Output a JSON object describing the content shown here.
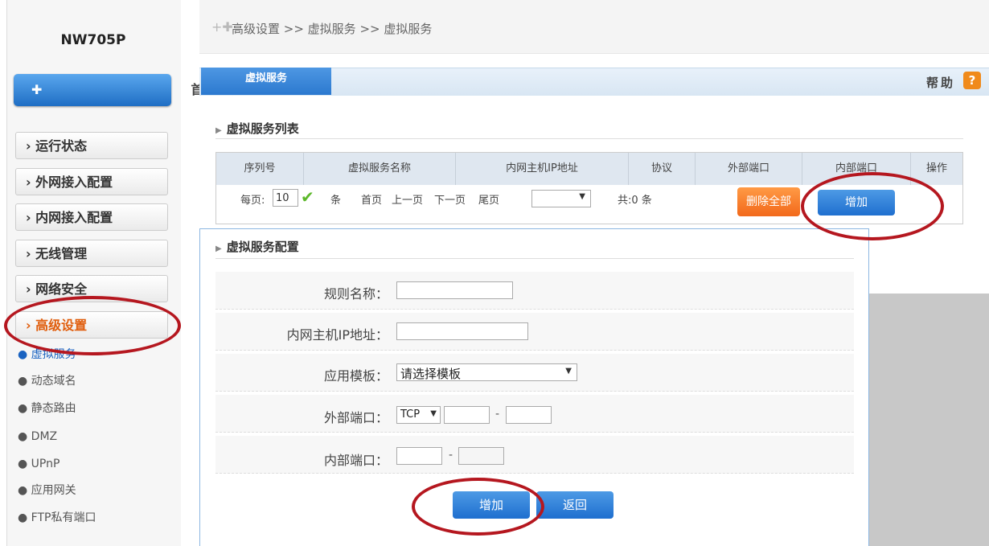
{
  "sidebar": {
    "model": "NW705P",
    "home": {
      "icon": "plus-icon",
      "label": "首 页"
    },
    "menu": [
      {
        "label": "› 运行状态"
      },
      {
        "label": "› 外网接入配置"
      },
      {
        "label": "› 内网接入配置"
      },
      {
        "label": "› 无线管理"
      },
      {
        "label": "› 网络安全"
      },
      {
        "label": "› 高级设置"
      }
    ],
    "submenu": [
      {
        "label": "● 虚拟服务"
      },
      {
        "label": "● 动态域名"
      },
      {
        "label": "● 静态路由"
      },
      {
        "label": "● DMZ"
      },
      {
        "label": "● UPnP"
      },
      {
        "label": "● 应用网关"
      },
      {
        "label": "● FTP私有端口"
      }
    ]
  },
  "breadcrumb": "高级设置 >> 虚拟服务 >> 虚拟服务",
  "tab": "虚拟服务",
  "help": {
    "label": "帮助",
    "icon": "?"
  },
  "list": {
    "title": "虚拟服务列表",
    "columns": [
      "序列号",
      "虚拟服务名称",
      "内网主机IP地址",
      "协议",
      "外部端口",
      "内部端口",
      "操作"
    ],
    "pager": {
      "per_page_label": "每页:",
      "per_page_value": "10",
      "unit": "条",
      "first": "首页",
      "prev": "上一页",
      "next": "下一页",
      "last": "尾页",
      "total": "共:0 条"
    },
    "delete_all": "删除全部",
    "add": "增加"
  },
  "config": {
    "title": "虚拟服务配置",
    "rule_name_label": "规则名称：",
    "ip_label": "内网主机IP地址：",
    "template_label": "应用模板：",
    "template_value": "请选择模板",
    "ext_port_label": "外部端口：",
    "protocol_value": "TCP",
    "int_port_label": "内部端口：",
    "dash": "-",
    "add": "增加",
    "back": "返回"
  },
  "colors": {
    "accent": "#2c79cf",
    "highlight": "#e05d0c",
    "annotation": "#b5171f"
  }
}
